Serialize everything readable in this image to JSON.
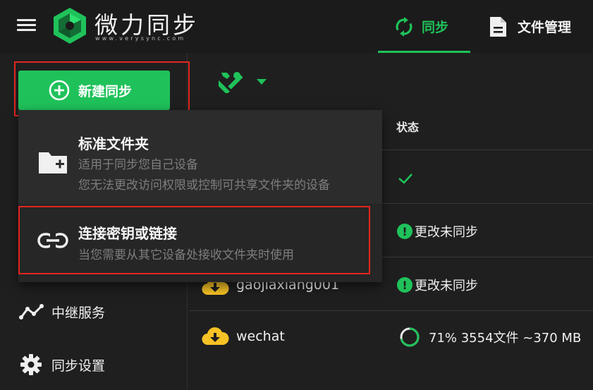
{
  "header": {
    "brand_name": "微力同步",
    "brand_url": "www.verysync.com",
    "tabs": [
      {
        "label": "同步",
        "icon": "sync-icon",
        "active": true
      },
      {
        "label": "文件管理",
        "icon": "document-icon",
        "active": false
      }
    ]
  },
  "sidebar": {
    "new_sync_label": "新建同步",
    "items": [
      {
        "label": "中继服务",
        "icon": "relay-chart-icon"
      },
      {
        "label": "同步设置",
        "icon": "gear-icon"
      }
    ]
  },
  "toolbar": {
    "tools_icon": "tools-icon"
  },
  "table": {
    "status_header": "状态",
    "rows": [
      {
        "name": "",
        "status": "",
        "status_icon": "check-icon"
      },
      {
        "name": "",
        "status": "更改未同步",
        "status_icon": "warning-icon"
      },
      {
        "name": "gaojiaxiang001",
        "status": "更改未同步",
        "status_icon": "warning-icon"
      },
      {
        "name": "wechat",
        "status": "71% 3554文件 ~370 MB",
        "status_icon": "progress-ring-icon",
        "progress": 0.71
      }
    ]
  },
  "dropdown": {
    "items": [
      {
        "title": "标准文件夹",
        "desc1": "适用于同步您自己设备",
        "desc2": "您无法更改访问权限或控制可共享文件夹的设备",
        "icon": "folder-add-icon"
      },
      {
        "title": "连接密钥或链接",
        "desc1": "当您需要从其它设备处接收文件夹时使用",
        "icon": "link-icon"
      }
    ]
  },
  "colors": {
    "accent": "#1fc25a",
    "highlight_frame": "#e0261f",
    "folder_yellow": "#f7c225"
  }
}
